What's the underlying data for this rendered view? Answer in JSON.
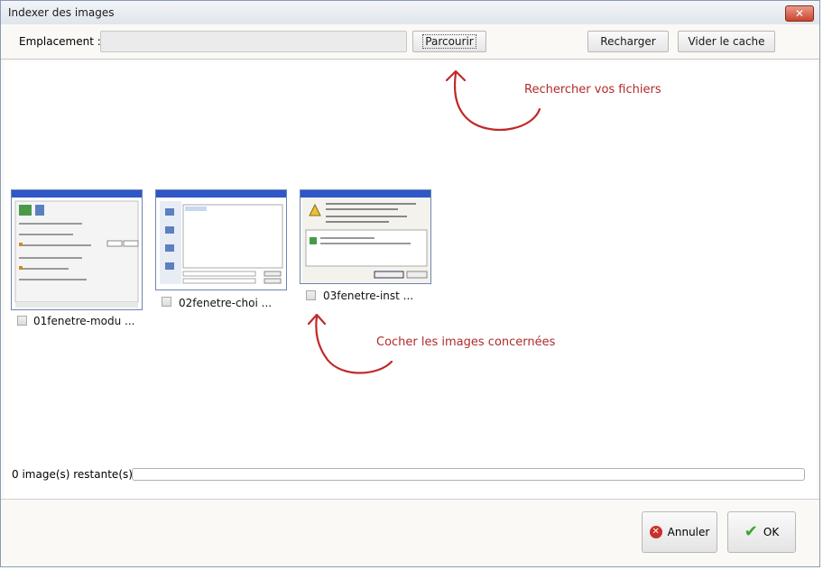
{
  "window": {
    "title": "Indexer des images",
    "close_glyph": "✕"
  },
  "toolbar": {
    "location_label": "Emplacement :",
    "location_value": "",
    "browse_label": "Parcourir",
    "reload_label": "Recharger",
    "clear_cache_label": "Vider le cache"
  },
  "images": [
    {
      "label": "01fenetre-modu ..."
    },
    {
      "label": "02fenetre-choi ..."
    },
    {
      "label": "03fenetre-inst ..."
    }
  ],
  "annotations": {
    "browse_hint": "Rechercher vos fichiers",
    "check_hint": "Cocher les images concernées"
  },
  "status": {
    "remaining_label": "0 image(s) restante(s)",
    "progress": 0
  },
  "footer": {
    "cancel_label": "Annuler",
    "ok_label": "OK"
  },
  "colors": {
    "annotation": "#b22a2a",
    "thumbnail_titlebar": "#2e57c7"
  }
}
